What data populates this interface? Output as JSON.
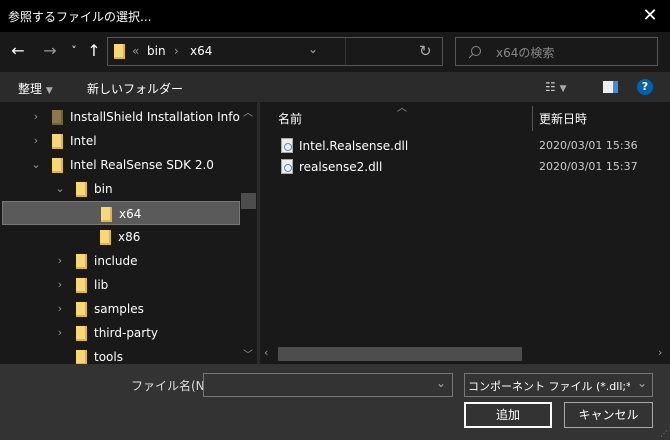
{
  "window": {
    "title": "参照するファイルの選択...",
    "close": "✕"
  },
  "nav": {
    "back": "←",
    "forward": "→",
    "recent": "˅",
    "up": "↑",
    "breadcrumb": [
      "«",
      "bin",
      "›",
      "x64"
    ],
    "refresh": "↻",
    "dropdown": "⌄",
    "search_placeholder": "x64の検索"
  },
  "toolbar": {
    "organize": "整理",
    "new_folder": "新しいフォルダー"
  },
  "tree": [
    {
      "label": "InstallShield Installation Informat",
      "level": 0,
      "expander": "›",
      "dim": true
    },
    {
      "label": "Intel",
      "level": 0,
      "expander": "›"
    },
    {
      "label": "Intel RealSense SDK 2.0",
      "level": 0,
      "expander": "⌄"
    },
    {
      "label": "bin",
      "level": 1,
      "expander": "⌄"
    },
    {
      "label": "x64",
      "level": 2,
      "expander": "",
      "selected": true
    },
    {
      "label": "x86",
      "level": 2,
      "expander": ""
    },
    {
      "label": "include",
      "level": 1,
      "expander": "›"
    },
    {
      "label": "lib",
      "level": 1,
      "expander": "›"
    },
    {
      "label": "samples",
      "level": 1,
      "expander": "›"
    },
    {
      "label": "third-party",
      "level": 1,
      "expander": "›"
    },
    {
      "label": "tools",
      "level": 1,
      "expander": ""
    }
  ],
  "files": {
    "columns": [
      "名前",
      "更新日時"
    ],
    "rows": [
      {
        "name": "Intel.Realsense.dll",
        "modified": "2020/03/01 15:36"
      },
      {
        "name": "realsense2.dll",
        "modified": "2020/03/01 15:37"
      }
    ]
  },
  "bottom": {
    "filename_label": "ファイル名(N):",
    "filename_value": "",
    "filter": "コンポーネント ファイル (*.dll;*.tlb;*.",
    "add": "追加",
    "cancel": "キャンセル"
  },
  "colors": {
    "folder": "#f8d775",
    "accent": "#0063b1"
  }
}
